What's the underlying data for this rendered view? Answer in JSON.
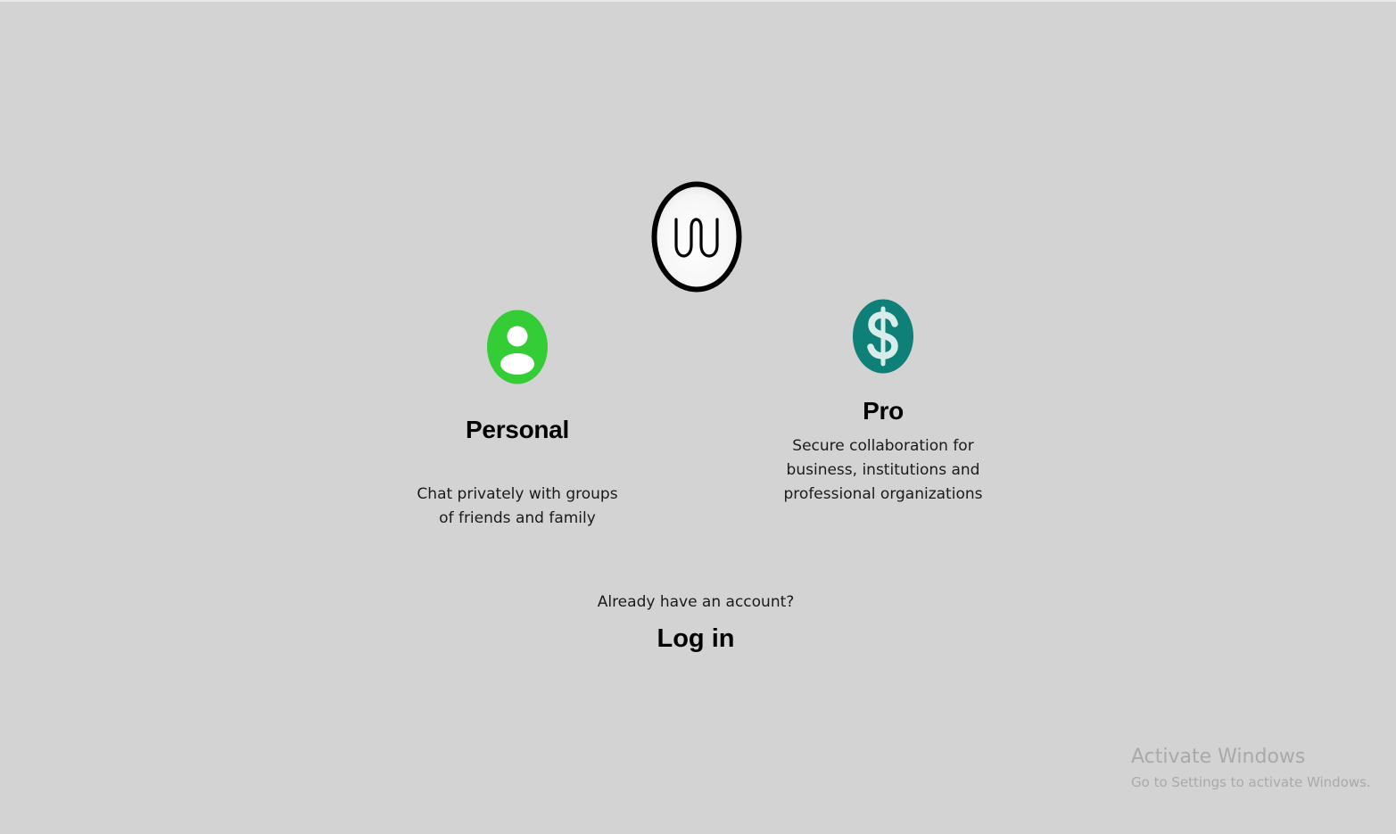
{
  "logo": {
    "icon": "wire-logo-icon"
  },
  "options": {
    "personal": {
      "title": "Personal",
      "description": "Chat privately with groups of friends and family",
      "icon": "person-icon",
      "color": "#35cd35"
    },
    "pro": {
      "title": "Pro",
      "description": "Secure collaboration for business, institutions and professional organizations",
      "icon": "dollar-icon",
      "color": "#0e8078"
    }
  },
  "login": {
    "prompt": "Already have an account?",
    "link": "Log in"
  },
  "watermark": {
    "title": "Activate Windows",
    "subtitle": "Go to Settings to activate Windows."
  },
  "colors": {
    "background": "#d3d3d3",
    "text": "#000000",
    "watermark": "#a9a9a9"
  }
}
